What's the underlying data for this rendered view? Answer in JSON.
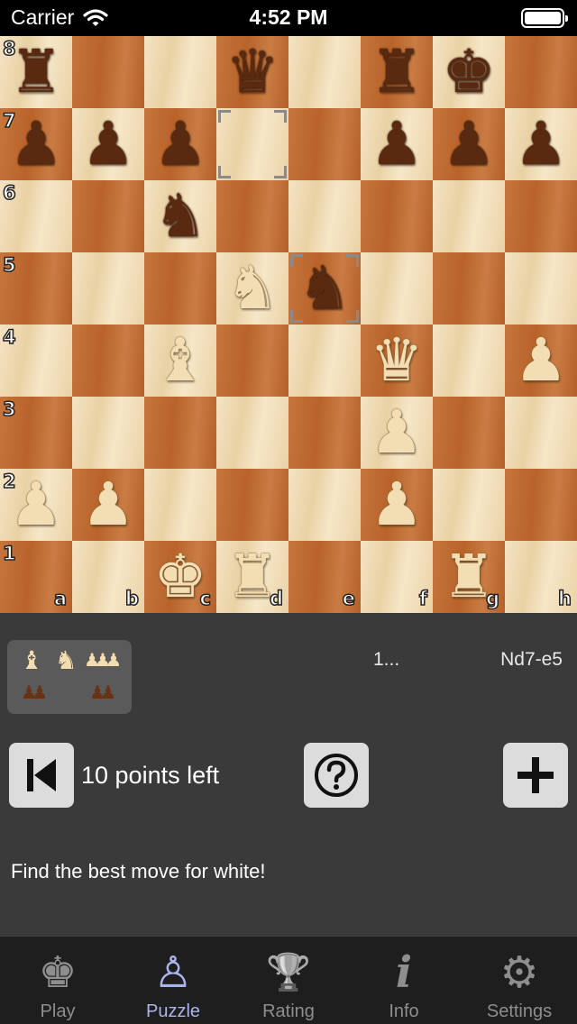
{
  "status_bar": {
    "carrier": "Carrier",
    "time": "4:52 PM"
  },
  "board": {
    "ranks": [
      "8",
      "7",
      "6",
      "5",
      "4",
      "3",
      "2",
      "1"
    ],
    "files": [
      "a",
      "b",
      "c",
      "d",
      "e",
      "f",
      "g",
      "h"
    ],
    "pieces": {
      "a8": "bR",
      "d8": "bQ",
      "f8": "bR",
      "g8": "bK",
      "a7": "bP",
      "b7": "bP",
      "c7": "bP",
      "f7": "bP",
      "g7": "bP",
      "h7": "bP",
      "c6": "bN",
      "d5": "wN",
      "e5": "bN",
      "c4": "wB",
      "f4": "wQ",
      "h4": "wP",
      "f3": "wP",
      "a2": "wP",
      "b2": "wP",
      "f2": "wP",
      "c1": "wK",
      "d1": "wR",
      "g1": "wR"
    },
    "last_move_from": "d7",
    "last_move_to": "e5"
  },
  "captured": {
    "white": [
      "♝",
      "♞",
      "♟♟♟"
    ],
    "black": [
      "♟♟",
      "",
      "♟♟"
    ]
  },
  "move": {
    "number": "1...",
    "text": "Nd7-e5"
  },
  "points_text": "10 points left",
  "hint": "Find the best move for white!",
  "tabs": [
    {
      "id": "play",
      "label": "Play",
      "icon": "king-icon",
      "glyph": "♚"
    },
    {
      "id": "puzzle",
      "label": "Puzzle",
      "icon": "pawn-icon",
      "glyph": "♙"
    },
    {
      "id": "rating",
      "label": "Rating",
      "icon": "trophy-icon",
      "glyph": "🏆"
    },
    {
      "id": "info",
      "label": "Info",
      "icon": "info-icon",
      "glyph": "i"
    },
    {
      "id": "settings",
      "label": "Settings",
      "icon": "gear-icon",
      "glyph": "⚙"
    }
  ],
  "active_tab": "puzzle"
}
